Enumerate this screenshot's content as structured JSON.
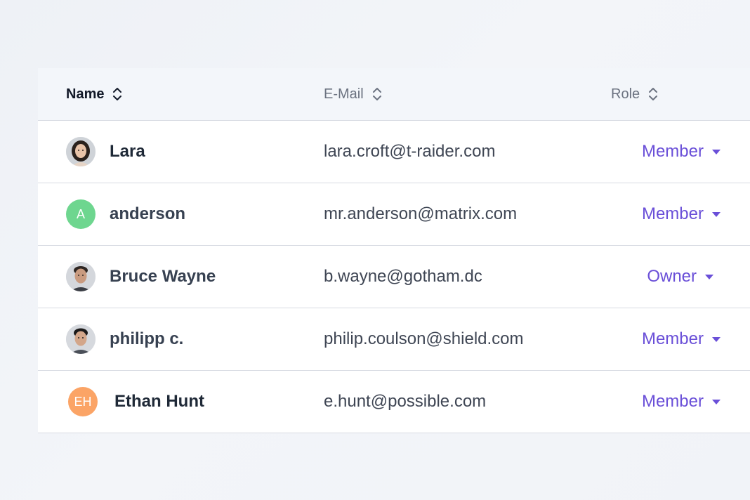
{
  "table": {
    "headers": {
      "name": "Name",
      "email": "E-Mail",
      "role": "Role"
    },
    "rows": [
      {
        "avatar_type": "photo",
        "avatar_icon": "woman-portrait",
        "name": "Lara",
        "email": "lara.croft@t-raider.com",
        "role": "Member"
      },
      {
        "avatar_type": "initials",
        "initials": "A",
        "avatar_color": "#6ed68f",
        "name": "anderson",
        "email": "mr.anderson@matrix.com",
        "role": "Member"
      },
      {
        "avatar_type": "photo",
        "avatar_icon": "man-portrait",
        "name": "Bruce Wayne",
        "email": "b.wayne@gotham.dc",
        "role": "Owner"
      },
      {
        "avatar_type": "photo",
        "avatar_icon": "man-portrait",
        "name": "philipp c.",
        "email": "philip.coulson@shield.com",
        "role": "Member"
      },
      {
        "avatar_type": "initials",
        "initials": "EH",
        "avatar_color": "#fba466",
        "name": "Ethan Hunt",
        "email": "e.hunt@possible.com",
        "role": "Member"
      }
    ]
  },
  "colors": {
    "accent": "#6a4fd8",
    "header_bg": "#f3f6fa",
    "divider": "#d7dbe2"
  }
}
